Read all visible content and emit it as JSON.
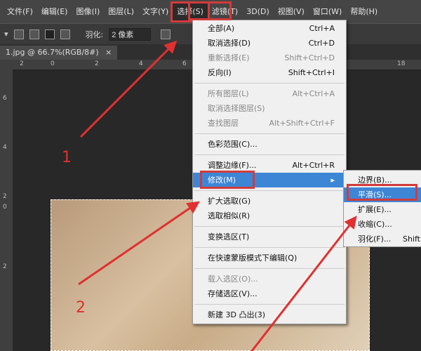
{
  "menubar": [
    "文件(F)",
    "编辑(E)",
    "图像(I)",
    "图层(L)",
    "文字(Y)",
    "选择(S)",
    "滤镜(T)",
    "3D(D)",
    "视图(V)",
    "窗口(W)",
    "帮助(H)"
  ],
  "toolbar": {
    "feather_label": "羽化:",
    "feather_value": "2 像素"
  },
  "document_tab": {
    "title": "1.jpg @ 66.7%(RGB/8#)",
    "close": "×"
  },
  "ruler_h": [
    "2",
    "0",
    "2",
    "4",
    "6",
    "18"
  ],
  "ruler_v": [
    "6",
    "4",
    "2",
    "0",
    "2"
  ],
  "select_menu": [
    {
      "label": "全部(A)",
      "shortcut": "Ctrl+A"
    },
    {
      "label": "取消选择(D)",
      "shortcut": "Ctrl+D"
    },
    {
      "label": "重新选择(E)",
      "shortcut": "Shift+Ctrl+D",
      "disabled": true
    },
    {
      "label": "反向(I)",
      "shortcut": "Shift+Ctrl+I"
    },
    {
      "label": "所有图层(L)",
      "shortcut": "Alt+Ctrl+A",
      "disabled": true
    },
    {
      "label": "取消选择图层(S)",
      "shortcut": "",
      "disabled": true
    },
    {
      "label": "查找图层",
      "shortcut": "Alt+Shift+Ctrl+F",
      "disabled": true
    },
    {
      "label": "色彩范围(C)...",
      "shortcut": ""
    },
    {
      "label": "调整边缘(F)...",
      "shortcut": "Alt+Ctrl+R"
    },
    {
      "label": "修改(M)",
      "shortcut": "▸"
    },
    {
      "label": "扩大选取(G)",
      "shortcut": ""
    },
    {
      "label": "选取相似(R)",
      "shortcut": ""
    },
    {
      "label": "变换选区(T)",
      "shortcut": ""
    },
    {
      "label": "在快速蒙版模式下编辑(Q)",
      "shortcut": ""
    },
    {
      "label": "载入选区(O)...",
      "shortcut": "",
      "disabled": true
    },
    {
      "label": "存储选区(V)...",
      "shortcut": ""
    },
    {
      "label": "新建 3D 凸出(3)",
      "shortcut": ""
    }
  ],
  "modify_submenu": [
    {
      "label": "边界(B)...",
      "shortcut": ""
    },
    {
      "label": "平滑(S)...",
      "shortcut": ""
    },
    {
      "label": "扩展(E)...",
      "shortcut": ""
    },
    {
      "label": "收缩(C)...",
      "shortcut": ""
    },
    {
      "label": "羽化(F)...",
      "shortcut": "Shift"
    }
  ],
  "annotations": [
    "1",
    "2"
  ],
  "colors": {
    "highlight": "#3d86d6",
    "annotation": "#d23b3b"
  }
}
